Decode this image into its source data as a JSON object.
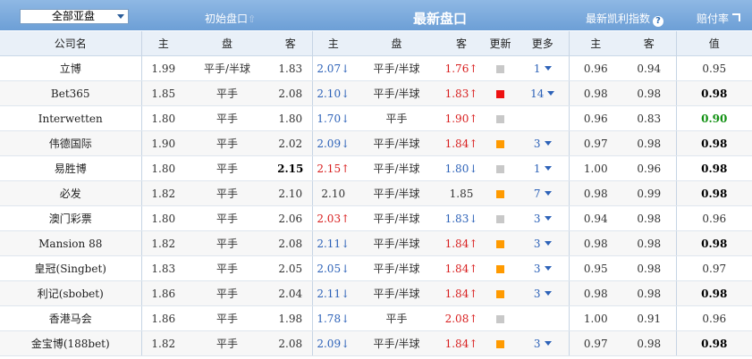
{
  "toolbar": {
    "select_value": "全部亚盘",
    "initial_label": "初始盘口",
    "latest_label": "最新盘口",
    "kelly_label": "最新凯利指数",
    "kelly_help": "?",
    "payout_label": "赔付率"
  },
  "headers": [
    "公司名",
    "主",
    "盘",
    "客",
    "主",
    "盘",
    "客",
    "更新",
    "更多",
    "主",
    "客",
    "值"
  ],
  "rows": [
    {
      "name": "立博",
      "h1": "1.99",
      "p1": "平手/半球",
      "a1": "1.83",
      "h2": "2.07↓",
      "p2": "平手/半球",
      "a2": "1.76↑",
      "upd": "gray",
      "more": "1",
      "kh": "0.96",
      "ka": "0.94",
      "val": "0.95"
    },
    {
      "name": "Bet365",
      "h1": "1.85",
      "p1": "平手",
      "a1": "2.08",
      "h2": "2.10↓",
      "p2": "平手/半球",
      "a2": "1.83↑",
      "upd": "red",
      "more": "14",
      "kh": "0.98",
      "ka": "0.98",
      "val": "0.98"
    },
    {
      "name": "Interwetten",
      "h1": "1.80",
      "p1": "平手",
      "a1": "1.80",
      "h2": "1.70↓",
      "p2": "平手",
      "a2": "1.90↑",
      "upd": "gray",
      "more": "",
      "kh": "0.96",
      "ka": "0.83",
      "val": "0.90"
    },
    {
      "name": "伟德国际",
      "h1": "1.90",
      "p1": "平手",
      "a1": "2.02",
      "h2": "2.09↓",
      "p2": "平手/半球",
      "a2": "1.84↑",
      "upd": "orange",
      "more": "3",
      "kh": "0.97",
      "ka": "0.98",
      "val": "0.98"
    },
    {
      "name": "易胜博",
      "h1": "1.80",
      "p1": "平手",
      "a1": "2.15",
      "h2": "2.15↑",
      "p2": "平手/半球",
      "a2": "1.80↓",
      "upd": "gray",
      "more": "1",
      "kh": "1.00",
      "ka": "0.96",
      "val": "0.98"
    },
    {
      "name": "必发",
      "h1": "1.82",
      "p1": "平手",
      "a1": "2.10",
      "h2": "2.10",
      "p2": "平手/半球",
      "a2": "1.85",
      "upd": "orange",
      "more": "7",
      "kh": "0.98",
      "ka": "0.99",
      "val": "0.98"
    },
    {
      "name": "澳门彩票",
      "h1": "1.80",
      "p1": "平手",
      "a1": "2.06",
      "h2": "2.03↑",
      "p2": "平手/半球",
      "a2": "1.83↓",
      "upd": "gray",
      "more": "3",
      "kh": "0.94",
      "ka": "0.98",
      "val": "0.96"
    },
    {
      "name": "Mansion 88",
      "h1": "1.82",
      "p1": "平手",
      "a1": "2.08",
      "h2": "2.11↓",
      "p2": "平手/半球",
      "a2": "1.84↑",
      "upd": "orange",
      "more": "3",
      "kh": "0.98",
      "ka": "0.98",
      "val": "0.98"
    },
    {
      "name": "皇冠(Singbet)",
      "h1": "1.83",
      "p1": "平手",
      "a1": "2.05",
      "h2": "2.05↓",
      "p2": "平手/半球",
      "a2": "1.84↑",
      "upd": "orange",
      "more": "3",
      "kh": "0.95",
      "ka": "0.98",
      "val": "0.97"
    },
    {
      "name": "利记(sbobet)",
      "h1": "1.86",
      "p1": "平手",
      "a1": "2.04",
      "h2": "2.11↓",
      "p2": "平手/半球",
      "a2": "1.84↑",
      "upd": "orange",
      "more": "3",
      "kh": "0.98",
      "ka": "0.98",
      "val": "0.98"
    },
    {
      "name": "香港马会",
      "h1": "1.86",
      "p1": "平手",
      "a1": "1.98",
      "h2": "1.78↓",
      "p2": "平手",
      "a2": "2.08↑",
      "upd": "gray",
      "more": "",
      "kh": "1.00",
      "ka": "0.91",
      "val": "0.96"
    },
    {
      "name": "金宝博(188bet)",
      "h1": "1.82",
      "p1": "平手",
      "a1": "2.08",
      "h2": "2.09↓",
      "p2": "平手/半球",
      "a2": "1.84↑",
      "upd": "orange",
      "more": "3",
      "kh": "0.97",
      "ka": "0.98",
      "val": "0.98"
    }
  ],
  "colors": {
    "header_bg": "#7aa8dc",
    "up": "#d81e1e",
    "down": "#2d62b8",
    "green": "#129113"
  }
}
